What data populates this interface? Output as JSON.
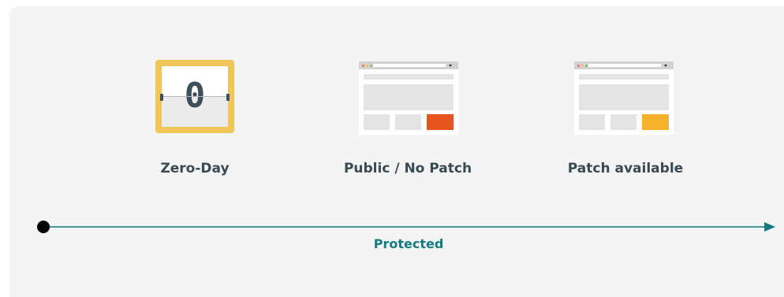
{
  "stages": [
    {
      "label": "Zero-Day",
      "icon": "flip-clock-icon",
      "digit": "0"
    },
    {
      "label": "Public / No Patch",
      "icon": "browser-window-icon",
      "accent": "#e8541e"
    },
    {
      "label": "Patch available",
      "icon": "browser-window-icon",
      "accent": "#f8b12c"
    }
  ],
  "timeline": {
    "label": "Protected",
    "color": "#137a80",
    "start_marker": "filled-circle",
    "end_marker": "arrowhead"
  },
  "colors": {
    "panel": "#f4f4f4",
    "text": "#3a4a52",
    "clock_frame": "#f0c65a",
    "browser_dots": [
      "#f06e6e",
      "#f5c04a",
      "#6cc46c"
    ]
  }
}
